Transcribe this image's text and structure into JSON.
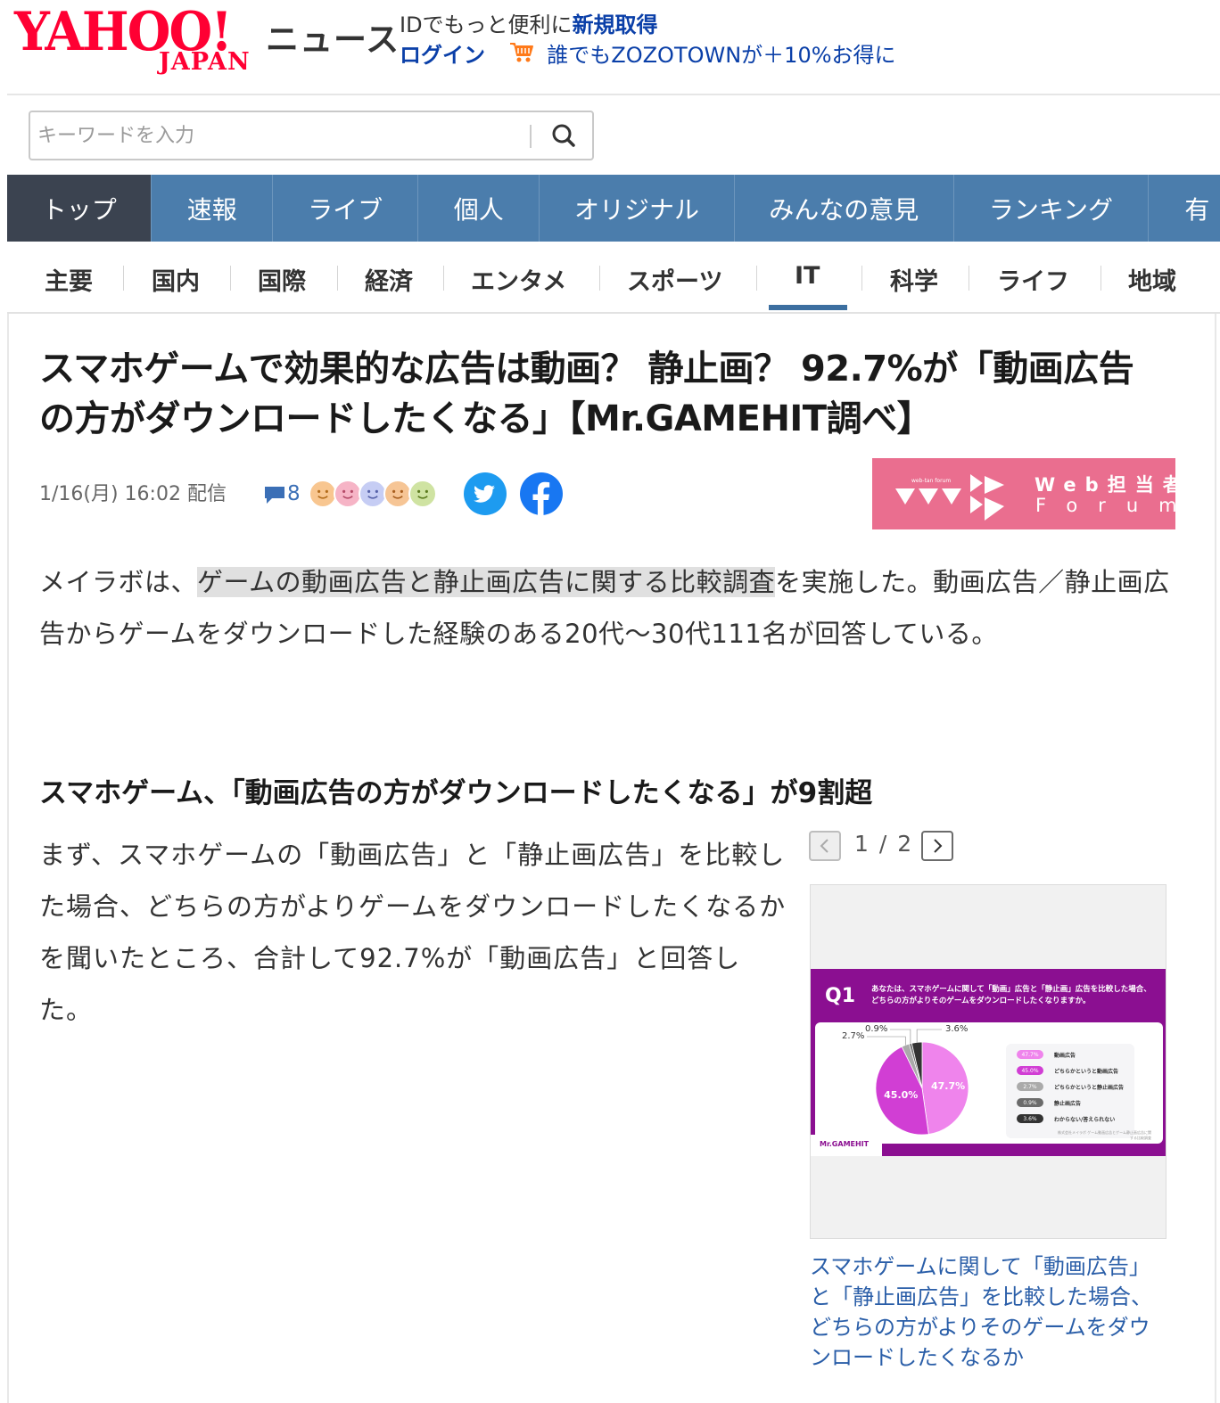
{
  "header": {
    "logo_yahoo": "YAHOO!",
    "logo_japan": "JAPAN",
    "news_label": "ニュース",
    "id_promo_prefix": "IDでもっと便利に",
    "register_link": "新規取得",
    "login_link": "ログイン",
    "promo_link": "誰でもZOZOTOWNが＋10%お得に"
  },
  "search": {
    "placeholder": "キーワードを入力"
  },
  "main_nav": [
    {
      "label": "トップ",
      "active": true
    },
    {
      "label": "速報"
    },
    {
      "label": "ライブ"
    },
    {
      "label": "個人"
    },
    {
      "label": "オリジナル"
    },
    {
      "label": "みんなの意見"
    },
    {
      "label": "ランキング"
    },
    {
      "label": "有"
    }
  ],
  "sub_nav": [
    {
      "label": "主要"
    },
    {
      "label": "国内"
    },
    {
      "label": "国際"
    },
    {
      "label": "経済"
    },
    {
      "label": "エンタメ"
    },
    {
      "label": "スポーツ"
    },
    {
      "label": "IT",
      "active": true
    },
    {
      "label": "科学"
    },
    {
      "label": "ライフ"
    },
    {
      "label": "地域"
    }
  ],
  "article": {
    "headline": "スマホゲームで効果的な広告は動画？ 静止画？ 92.7%が「動画広告の方がダウンロードしたくなる」【Mr.GAMEHIT調べ】",
    "date": "1/16(月) 16:02 配信",
    "comment_count": "8",
    "source": {
      "small_label": "web-tan forum",
      "line1": "Web担当者",
      "line2": "Forum"
    },
    "lead_pre": "メイラボは、",
    "lead_highlight": "ゲームの動画広告と静止画広告に関する比較調査",
    "lead_post": "を実施した。動画広告／静止画広告からゲームをダウンロードした経験のある20代〜30代111名が回答している。",
    "subhead": "スマホゲーム、「動画広告の方がダウンロードしたくなる」が9割超",
    "body": "まず、スマホゲームの「動画広告」と「静止画広告」を比較した場合、どちらの方がよりゲームをダウンロードしたくなるかを聞いたところ、合計して92.7%が「動画広告」と回答した。"
  },
  "gallery": {
    "counter": "1 / 2",
    "caption": "スマホゲームに関して「動画広告」と「静止画広告」を比較した場合、どちらの方がよりそのゲームをダウンロードしたくなるか"
  },
  "chart_data": {
    "type": "pie",
    "title": "Q1",
    "question": "あなたは、スマホゲームに関して「動画」広告と「静止画」広告を比較した場合、どちらの方がよりそのゲームをダウンロードしたくなりますか。",
    "slices": [
      {
        "label": "動画広告",
        "value": 47.7,
        "display": "47.7%",
        "color": "#ef84ec"
      },
      {
        "label": "どちらかというと動画広告",
        "value": 45.0,
        "display": "45.0%",
        "color": "#d13ed4"
      },
      {
        "label": "どちらかというと静止画広告",
        "value": 2.7,
        "display": "2.7%",
        "color": "#aaaaaa"
      },
      {
        "label": "静止画広告",
        "value": 0.9,
        "display": "0.9%",
        "color": "#6b6b6b"
      },
      {
        "label": "わからない/答えられない",
        "value": 3.6,
        "display": "3.6%",
        "color": "#333333"
      }
    ],
    "brand": "Mr.GAMEHIT",
    "footnote": "株式会社メイラボ ゲーム動画広告とゲーム静止画広告に関する比較調査"
  },
  "colors": {
    "brand_red": "#ff0033",
    "nav_blue": "#4b7dac",
    "nav_active": "#3b4350",
    "link_blue": "#2a5ea8",
    "source_pink": "#ea6e8f",
    "chart_purple": "#8b0f91"
  },
  "icons": {
    "search": "search-icon",
    "cart": "cart-icon",
    "comment": "comment-icon",
    "twitter": "twitter-icon",
    "facebook": "facebook-icon",
    "prev": "chevron-left-icon",
    "next": "chevron-right-icon"
  }
}
